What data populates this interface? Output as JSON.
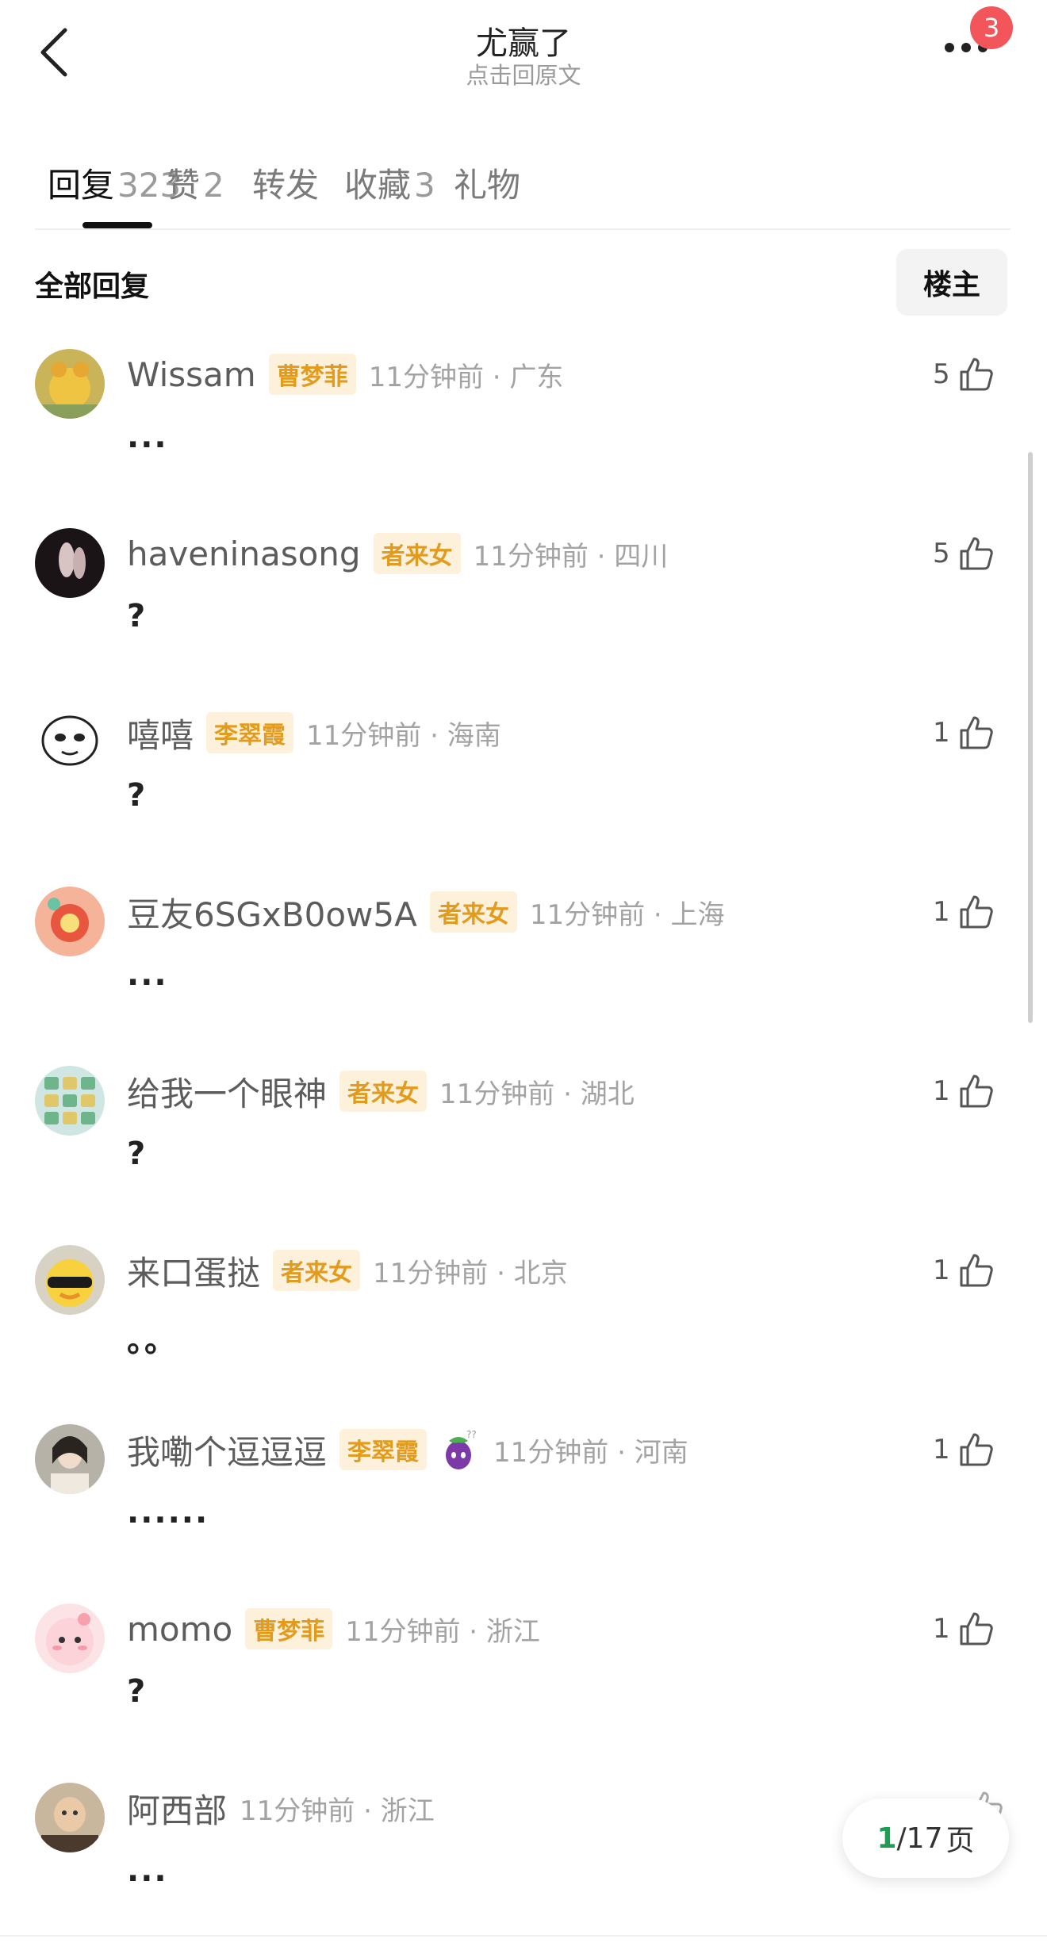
{
  "header": {
    "title": "尤赢了",
    "subtitle": "点击回原文",
    "notification_count": "3"
  },
  "tabs": [
    {
      "label": "回复",
      "count": "323"
    },
    {
      "label": "赞",
      "count": "2"
    },
    {
      "label": "转发",
      "count": ""
    },
    {
      "label": "收藏",
      "count": "3"
    },
    {
      "label": "礼物",
      "count": ""
    }
  ],
  "section": {
    "title": "全部回复",
    "filter_label": "楼主"
  },
  "replies": [
    {
      "username": "Wissam",
      "tag": "曹梦菲",
      "time": "11分钟前",
      "location": "广东",
      "text": "...",
      "likes": "5"
    },
    {
      "username": "haveninasong",
      "tag": "者来女",
      "time": "11分钟前",
      "location": "四川",
      "text": "?",
      "likes": "5"
    },
    {
      "username": "嘻嘻",
      "tag": "李翠霞",
      "time": "11分钟前",
      "location": "海南",
      "text": "?",
      "likes": "1"
    },
    {
      "username": "豆友6SGxB0ow5A",
      "tag": "者来女",
      "time": "11分钟前",
      "location": "上海",
      "text": "...",
      "likes": "1"
    },
    {
      "username": "给我一个眼神",
      "tag": "者来女",
      "time": "11分钟前",
      "location": "湖北",
      "text": "?",
      "likes": "1"
    },
    {
      "username": "来口蛋挞",
      "tag": "者来女",
      "time": "11分钟前",
      "location": "北京",
      "text": "。。",
      "likes": "1"
    },
    {
      "username": "我嘞个逗逗逗",
      "tag": "李翠霞",
      "time": "11分钟前",
      "location": "河南",
      "text": "......",
      "likes": "1"
    },
    {
      "username": "momo",
      "tag": "曹梦菲",
      "time": "11分钟前",
      "location": "浙江",
      "text": "?",
      "likes": "1"
    },
    {
      "username": "阿西部",
      "tag": "",
      "time": "11分钟前",
      "location": "浙江",
      "text": "...",
      "likes": ""
    }
  ],
  "pager": {
    "current": "1",
    "total": "/17",
    "unit": "页"
  },
  "colors": {
    "tag_bg": "#fdf1dc",
    "tag_text": "#e39b1e",
    "badge": "#f2555a",
    "pager_current": "#1f9d55"
  },
  "icons": [
    "back-arrow-icon",
    "more-dots-icon",
    "thumbs-up-icon",
    "eggplant-icon"
  ]
}
